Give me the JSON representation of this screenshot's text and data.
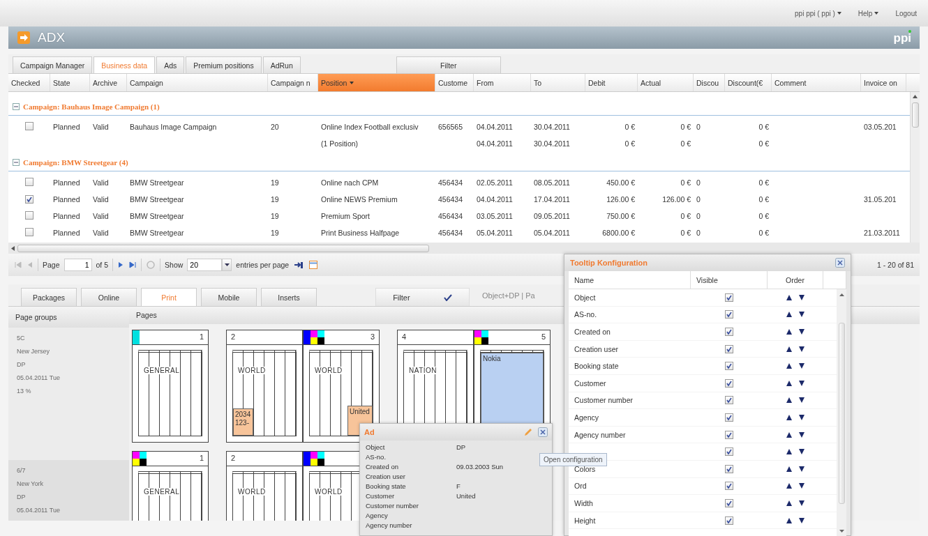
{
  "top_links": [
    {
      "label": "ppi ppi ( ppi )",
      "menu": true
    },
    {
      "label": "Help",
      "menu": true
    },
    {
      "label": "Logout",
      "menu": false
    }
  ],
  "app": {
    "title": "ADX",
    "logo": "ppi"
  },
  "tabs": [
    {
      "label": "Campaign Manager",
      "selected": false
    },
    {
      "label": "Business data",
      "selected": true
    },
    {
      "label": "Ads",
      "selected": false
    },
    {
      "label": "Premium positions",
      "selected": false
    },
    {
      "label": "AdRun",
      "selected": false
    }
  ],
  "filter_tab": "Filter",
  "table": {
    "columns": [
      {
        "label": "Checked",
        "sorted": false
      },
      {
        "label": "State",
        "sorted": false
      },
      {
        "label": "Archive",
        "sorted": false
      },
      {
        "label": "Campaign",
        "sorted": false
      },
      {
        "label": "Campaign n",
        "sorted": false
      },
      {
        "label": "Position",
        "sorted": true
      },
      {
        "label": "Custome",
        "sorted": false
      },
      {
        "label": "From",
        "sorted": false
      },
      {
        "label": "To",
        "sorted": false
      },
      {
        "label": "Debit",
        "sorted": false
      },
      {
        "label": "Actual",
        "sorted": false
      },
      {
        "label": "Discou",
        "sorted": false
      },
      {
        "label": "Discount(€",
        "sorted": false
      },
      {
        "label": "Comment",
        "sorted": false
      },
      {
        "label": "Invoice on",
        "sorted": false
      }
    ],
    "rows": [
      {
        "kind": "group",
        "label": "Campaign: Bauhaus Image Campaign (1)",
        "expanded": true
      },
      {
        "kind": "item",
        "checked": false,
        "cells": [
          "Planned",
          "Valid",
          "Bauhaus Image Campaign",
          "20",
          "Online Index Football exclusiv",
          "656565",
          "04.04.2011",
          "30.04.2011",
          "0 €",
          "0 €",
          "0",
          "0 €",
          null,
          "03.05.201"
        ]
      },
      {
        "kind": "summary",
        "cells": [
          null,
          null,
          null,
          null,
          "(1 Position)",
          null,
          "04.04.2011",
          "30.04.2011",
          "0 €",
          "0 €",
          null,
          "0 €",
          null,
          null
        ]
      },
      {
        "kind": "group",
        "label": "Campaign: BMW Streetgear (4)",
        "expanded": true
      },
      {
        "kind": "item",
        "checked": false,
        "cells": [
          "Planned",
          "Valid",
          "BMW Streetgear",
          "19",
          "Online nach CPM",
          "456434",
          "02.05.2011",
          "08.05.2011",
          "450.00 €",
          "0 €",
          "0",
          "0 €",
          null,
          null
        ]
      },
      {
        "kind": "item",
        "checked": true,
        "cells": [
          "Planned",
          "Valid",
          "BMW Streetgear",
          "19",
          "Online NEWS Premium",
          "456434",
          "04.04.2011",
          "17.04.2011",
          "126.00 €",
          "126.00 €",
          "0",
          "0 €",
          null,
          "31.05.201"
        ]
      },
      {
        "kind": "item",
        "checked": false,
        "cells": [
          "Planned",
          "Valid",
          "BMW Streetgear",
          "19",
          "Premium Sport",
          "456434",
          "03.05.2011",
          "09.05.2011",
          "750.00 €",
          "0 €",
          "0",
          "0 €",
          null,
          null
        ]
      },
      {
        "kind": "item",
        "checked": false,
        "cells": [
          "Planned",
          "Valid",
          "BMW Streetgear",
          "19",
          "Print Business Halfpage",
          "456434",
          "05.04.2011",
          "05.04.2011",
          "6800.00 €",
          "0 €",
          "0",
          "0 €",
          null,
          "21.03.2011"
        ]
      }
    ]
  },
  "pager": {
    "page_label": "Page",
    "page": "1",
    "of": "of 5",
    "show_label": "Show",
    "page_size": "20",
    "entries_label": "entries per page",
    "range": "1 - 20 of 81"
  },
  "planning": {
    "tabs": [
      {
        "label": "Packages",
        "selected": false
      },
      {
        "label": "Online",
        "selected": false
      },
      {
        "label": "Print",
        "selected": true
      },
      {
        "label": "Mobile",
        "selected": false
      },
      {
        "label": "Inserts",
        "selected": false
      }
    ],
    "filter": "Filter",
    "filter_text": "Object+DP | Pa",
    "columns": [
      "Page groups",
      "Pages"
    ],
    "page_groups": [
      {
        "selected": false,
        "lines": [
          "5C",
          "New Jersey",
          "DP",
          "05.04.2011 Tue",
          "13 %"
        ]
      },
      {
        "selected": true,
        "lines": [
          "6/7",
          "New York",
          "DP",
          "05.04.2011 Tue"
        ]
      }
    ],
    "page_rows": [
      {
        "spreads": [
          {
            "pages": [
              {
                "number": "1",
                "inks": [
                  {
                    "color": "#00e0e0"
                  }
                ],
                "section": "GENERAL"
              }
            ]
          },
          {
            "pages": [
              {
                "number": "2",
                "section": "WORLD",
                "ads": [
                  {
                    "label": "2034 123-",
                    "kind": "block",
                    "color": "#f7c49a"
                  }
                ]
              },
              {
                "number": "3",
                "inks": [
                  {
                    "color": "#0000ff"
                  },
                  {
                    "color": "#ff00ff"
                  },
                  {
                    "color": "#ffff00"
                  },
                  {
                    "color": "#00ffff"
                  },
                  {
                    "color": "#000000"
                  }
                ],
                "section": "WORLD",
                "ads": [
                  {
                    "label": "United",
                    "kind": "block",
                    "color": "#f7c49a"
                  }
                ]
              }
            ]
          },
          {
            "pages": [
              {
                "number": "4",
                "section": "NATION"
              },
              {
                "number": "5",
                "inks": [
                  {
                    "color": "#ff00ff"
                  },
                  {
                    "color": "#ffff00"
                  },
                  {
                    "color": "#00ffff"
                  },
                  {
                    "color": "#000000"
                  }
                ],
                "ads": [
                  {
                    "label": "Nokia",
                    "kind": "full",
                    "color": "#b9d0f2"
                  }
                ]
              }
            ]
          }
        ]
      },
      {
        "spreads": [
          {
            "pages": [
              {
                "number": "1",
                "inks": [
                  {
                    "color": "#ff00ff"
                  },
                  {
                    "color": "#ffff00"
                  },
                  {
                    "color": "#00ffff"
                  },
                  {
                    "color": "#000000"
                  }
                ],
                "section": "GENERAL"
              }
            ]
          },
          {
            "pages": [
              {
                "number": "2",
                "section": "WORLD"
              },
              {
                "inks": [
                  {
                    "color": "#0000ff"
                  },
                  {
                    "color": "#ff00ff"
                  },
                  {
                    "color": "#ffff00"
                  },
                  {
                    "color": "#00ffff"
                  },
                  {
                    "color": "#000000"
                  }
                ],
                "section": "WORLD"
              }
            ]
          }
        ]
      }
    ]
  },
  "ad_tooltip": {
    "title": "Ad",
    "rows": [
      {
        "label": "Object",
        "value": "DP"
      },
      {
        "label": "AS-no."
      },
      {
        "label": "Created on",
        "value": "09.03.2003 Sun"
      },
      {
        "label": "Creation user"
      },
      {
        "label": "Booking state",
        "value": "F"
      },
      {
        "label": "Customer",
        "value": "United"
      },
      {
        "label": "Customer number"
      },
      {
        "label": "Agency"
      },
      {
        "label": "Agency number"
      }
    ]
  },
  "hint": "Open configuration",
  "config_dialog": {
    "title": "Tooltip Konfiguration",
    "columns": [
      "Name",
      "Visible",
      "Order"
    ],
    "rows": [
      {
        "name": "Object",
        "visible": true
      },
      {
        "name": "AS-no.",
        "visible": true
      },
      {
        "name": "Created on",
        "visible": true
      },
      {
        "name": "Creation user",
        "visible": true
      },
      {
        "name": "Booking state",
        "visible": true
      },
      {
        "name": "Customer",
        "visible": true
      },
      {
        "name": "Customer number",
        "visible": true
      },
      {
        "name": "Agency",
        "visible": true
      },
      {
        "name": "Agency number",
        "visible": true
      },
      {
        "visible": true
      },
      {
        "name": "Colors",
        "visible": true
      },
      {
        "name": "Ord",
        "visible": true
      },
      {
        "name": "Width",
        "visible": true
      },
      {
        "name": "Height",
        "visible": true
      }
    ]
  }
}
